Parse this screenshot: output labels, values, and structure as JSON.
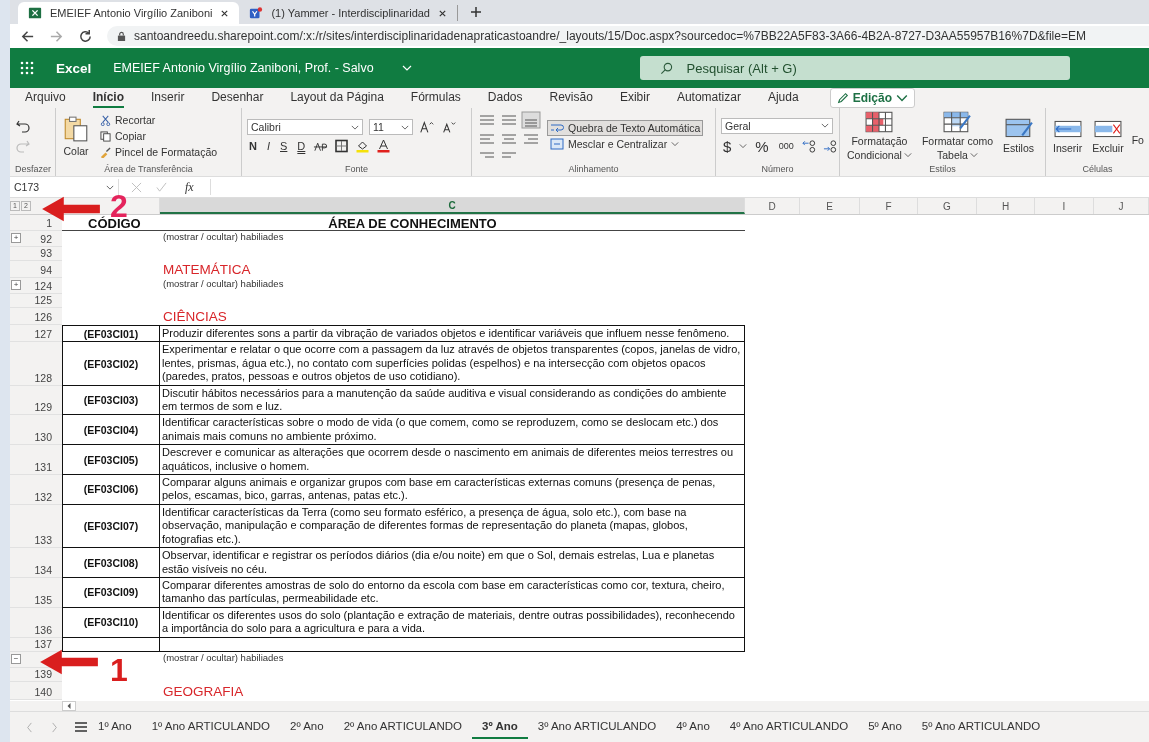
{
  "browser": {
    "tabs": [
      {
        "title": "EMEIEF Antonio Virgílio Zaniboni",
        "selected": true
      },
      {
        "title": "(1) Yammer - Interdisciplinaridad",
        "selected": false
      }
    ],
    "url": "santoandreedu.sharepoint.com/:x:/r/sites/interdisciplinaridadenapraticastoandre/_layouts/15/Doc.aspx?sourcedoc=%7BB22A5F83-3A66-4B2A-8727-D3AA55957B16%7D&file=EM"
  },
  "app": {
    "name": "Excel",
    "document": "EMEIEF Antonio Virgílio Zaniboni, Prof.  -  Salvo",
    "search": {
      "placeholder": "Pesquisar (Alt + G)"
    }
  },
  "ribbon_tabs": [
    {
      "label": "Arquivo",
      "selected": false
    },
    {
      "label": "Início",
      "selected": true
    },
    {
      "label": "Inserir",
      "selected": false
    },
    {
      "label": "Desenhar",
      "selected": false
    },
    {
      "label": "Layout da Página",
      "selected": false
    },
    {
      "label": "Fórmulas",
      "selected": false
    },
    {
      "label": "Dados",
      "selected": false
    },
    {
      "label": "Revisão",
      "selected": false
    },
    {
      "label": "Exibir",
      "selected": false
    },
    {
      "label": "Automatizar",
      "selected": false
    },
    {
      "label": "Ajuda",
      "selected": false
    }
  ],
  "mode": "Edição",
  "ribbon": {
    "undo": {
      "group": "Desfazer"
    },
    "clipboard": {
      "paste": "Colar",
      "cut": "Recortar",
      "copy": "Copiar",
      "painter": "Pincel de Formatação",
      "group": "Área de Transferência"
    },
    "font": {
      "family": "Calibri",
      "size": "11",
      "styles": [
        "N",
        "I",
        "S",
        "D"
      ],
      "group": "Fonte"
    },
    "alignment": {
      "wrap": "Quebra de Texto Automática",
      "wrap_on": true,
      "merge": "Mesclar e Centralizar",
      "group": "Alinhamento"
    },
    "number": {
      "format": "Geral",
      "currency": "$",
      "percent": "%",
      "thousands": "000",
      "group": "Número"
    },
    "styles": {
      "conditional": [
        "Formatação",
        "Condicional"
      ],
      "table": [
        "Formatar como",
        "Tabela"
      ],
      "cell": "Estilos",
      "group": "Estilos"
    },
    "cells": {
      "insert": "Inserir",
      "delete": "Excluir",
      "format": "Fo",
      "group": "Células"
    }
  },
  "formula_bar": {
    "name_box": "C173",
    "fx": "fx"
  },
  "outline_levels": [
    "1",
    "2"
  ],
  "columns": [
    "C",
    "D",
    "E",
    "F",
    "G",
    "H",
    "I",
    "J"
  ],
  "rows": [
    {
      "num": "1",
      "kind": "header",
      "code": "CÓDIGO",
      "text": "ÁREA DE CONHECIMENTO"
    },
    {
      "num": "92",
      "kind": "link",
      "text": "(mostrar / ocultar) habiliades",
      "outline": "+"
    },
    {
      "num": "93",
      "kind": "blank"
    },
    {
      "num": "94",
      "kind": "section",
      "text": "MATEMÁTICA"
    },
    {
      "num": "124",
      "kind": "link",
      "text": "(mostrar / ocultar) habiliades",
      "outline": "+"
    },
    {
      "num": "125",
      "kind": "blank"
    },
    {
      "num": "126",
      "kind": "section",
      "text": "CIÊNCIAS"
    },
    {
      "num": "127",
      "kind": "skill",
      "code": "(EF03CI01)",
      "text": "Produzir diferentes sons a partir da vibração de variados objetos e identificar variáveis que influem nesse fenômeno."
    },
    {
      "num": "128",
      "kind": "skill",
      "code": "(EF03CI02)",
      "text": "Experimentar e relatar o que ocorre com a passagem da luz através de objetos transparentes (copos, janelas de vidro, lentes, prismas, água etc.), no contato com superfícies polidas (espelhos) e na intersecção com objetos opacos (paredes, pratos, pessoas e outros objetos de uso cotidiano)."
    },
    {
      "num": "129",
      "kind": "skill",
      "code": "(EF03CI03)",
      "text": "Discutir hábitos necessários para a manutenção da saúde auditiva e visual considerando as condições do ambiente em termos de som e luz."
    },
    {
      "num": "130",
      "kind": "skill",
      "code": "(EF03CI04)",
      "text": "Identificar características sobre o modo de vida (o que comem, como se reproduzem, como se deslocam etc.) dos animais mais comuns no ambiente próximo."
    },
    {
      "num": "131",
      "kind": "skill",
      "code": "(EF03CI05)",
      "text": "Descrever e comunicar as alterações que ocorrem desde o nascimento em animais de diferentes meios terrestres ou aquáticos, inclusive o homem."
    },
    {
      "num": "132",
      "kind": "skill",
      "code": "(EF03CI06)",
      "text": "Comparar alguns animais e organizar grupos com base em características externas comuns (presença de penas, pelos, escamas, bico, garras, antenas, patas etc.)."
    },
    {
      "num": "133",
      "kind": "skill",
      "code": "(EF03CI07)",
      "text": "Identificar características da Terra (como seu formato esférico, a presença de água, solo etc.), com base na observação, manipulação e comparação de diferentes formas de representação do planeta (mapas, globos, fotografias etc.)."
    },
    {
      "num": "134",
      "kind": "skill",
      "code": "(EF03CI08)",
      "text": "Observar, identificar e registrar os períodos diários (dia e/ou noite) em que o Sol, demais estrelas, Lua e planetas estão visíveis no céu."
    },
    {
      "num": "135",
      "kind": "skill",
      "code": "(EF03CI09)",
      "text": "Comparar diferentes amostras de solo do entorno da escola com base em características como cor, textura, cheiro, tamanho das partículas, permeabilidade etc."
    },
    {
      "num": "136",
      "kind": "skill",
      "code": "(EF03CI10)",
      "text": "Identificar os diferentes usos do solo (plantação e extração de materiais, dentre outras possibilidades), reconhecendo a importância do solo para a agricultura e para a vida."
    },
    {
      "num": "137",
      "kind": "skill"
    },
    {
      "kind": "link",
      "text": "(mostrar / ocultar) habiliades",
      "outline": "−"
    },
    {
      "num": "139",
      "kind": "blank"
    },
    {
      "num": "140",
      "kind": "section",
      "text": "GEOGRAFIA"
    }
  ],
  "sheets": [
    {
      "label": "1º Ano",
      "selected": false
    },
    {
      "label": "1º Ano ARTICULANDO",
      "selected": false
    },
    {
      "label": "2º Ano",
      "selected": false
    },
    {
      "label": "2º Ano ARTICULANDO",
      "selected": false
    },
    {
      "label": "3º Ano",
      "selected": true
    },
    {
      "label": "3º Ano ARTICULANDO",
      "selected": false
    },
    {
      "label": "4º Ano",
      "selected": false
    },
    {
      "label": "4º Ano ARTICULANDO",
      "selected": false
    },
    {
      "label": "5º Ano",
      "selected": false
    },
    {
      "label": "5º Ano ARTICULANDO",
      "selected": false
    }
  ],
  "annotations": [
    {
      "label": "2"
    },
    {
      "label": "1"
    }
  ]
}
